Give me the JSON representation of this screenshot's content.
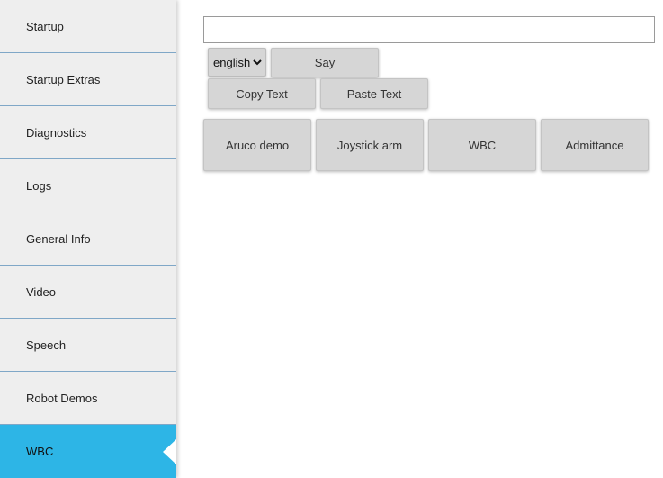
{
  "sidebar": {
    "items": [
      {
        "label": "Startup"
      },
      {
        "label": "Startup Extras"
      },
      {
        "label": "Diagnostics"
      },
      {
        "label": "Logs"
      },
      {
        "label": "General Info"
      },
      {
        "label": "Video"
      },
      {
        "label": "Speech"
      },
      {
        "label": "Robot Demos"
      },
      {
        "label": "WBC"
      }
    ],
    "active": "WBC",
    "active_color": "#2db5e6"
  },
  "speech": {
    "text_value": "",
    "language": "english",
    "say_label": "Say",
    "copy_label": "Copy Text",
    "paste_label": "Paste Text"
  },
  "demos": [
    {
      "label": "Aruco demo"
    },
    {
      "label": "Joystick arm"
    },
    {
      "label": "WBC"
    },
    {
      "label": "Admittance"
    }
  ]
}
